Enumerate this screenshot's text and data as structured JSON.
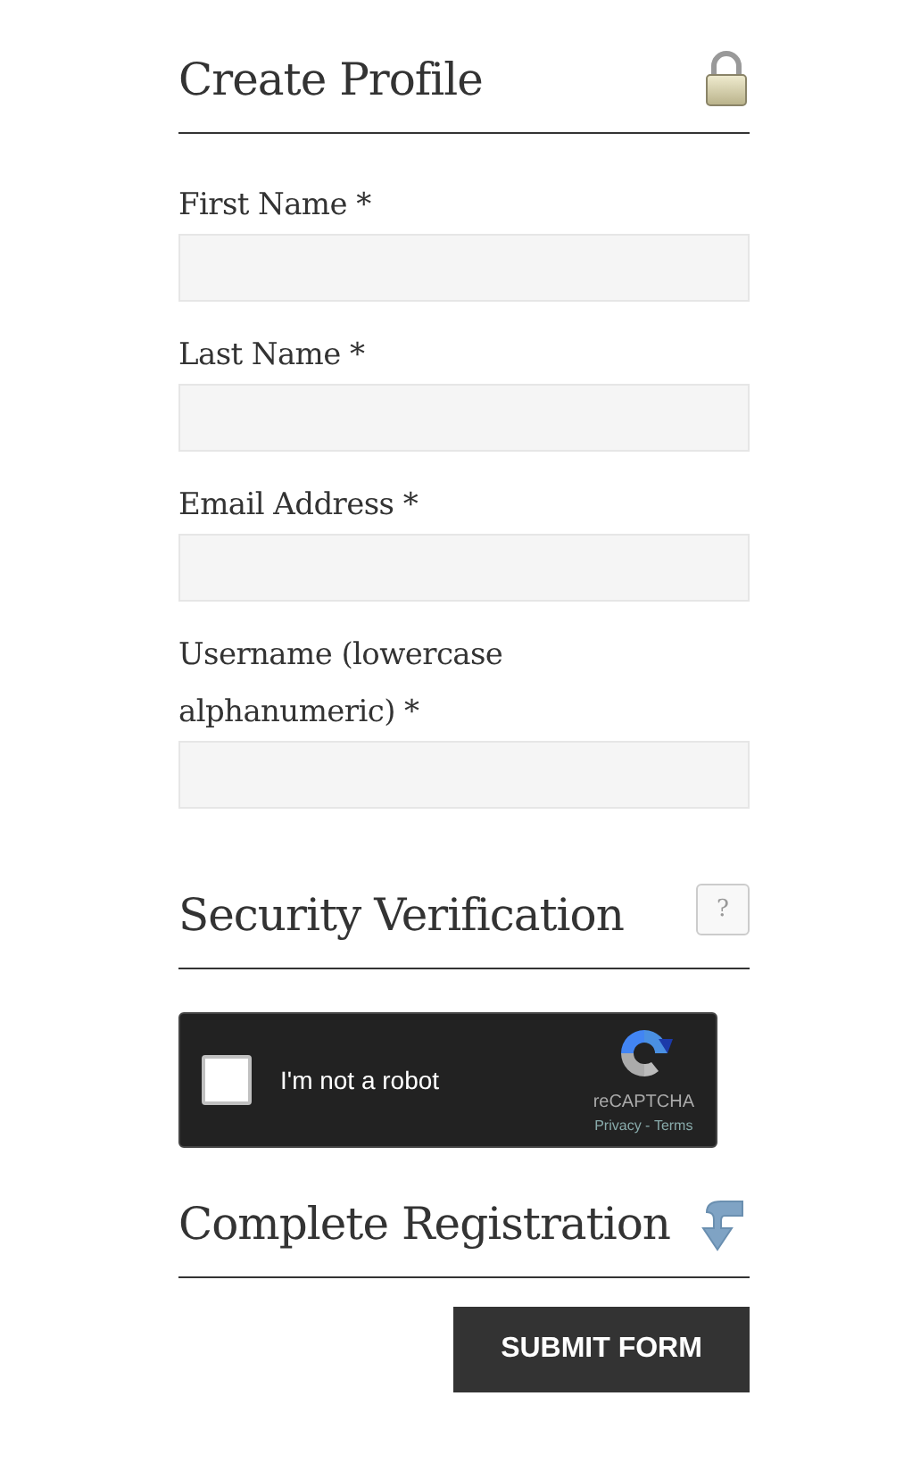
{
  "sections": [
    {
      "title": "Create Profile",
      "kind": "fields",
      "fields": [
        {
          "label": "First Name *"
        },
        {
          "label": "Last Name *"
        },
        {
          "label": "Email Address *"
        },
        {
          "label": "Username (lowercase alphanumeric) *"
        }
      ]
    },
    {
      "title": "Security Verification",
      "help_text": "?",
      "kind": "captcha",
      "captcha": {
        "label": "I'm not a robot",
        "checked": false,
        "brand": "reCAPTCHA",
        "links": [
          "Privacy",
          "Terms"
        ],
        "separator": " - "
      }
    },
    {
      "title": "Complete Registration",
      "kind": "submit",
      "button": "SUBMIT FORM"
    }
  ]
}
